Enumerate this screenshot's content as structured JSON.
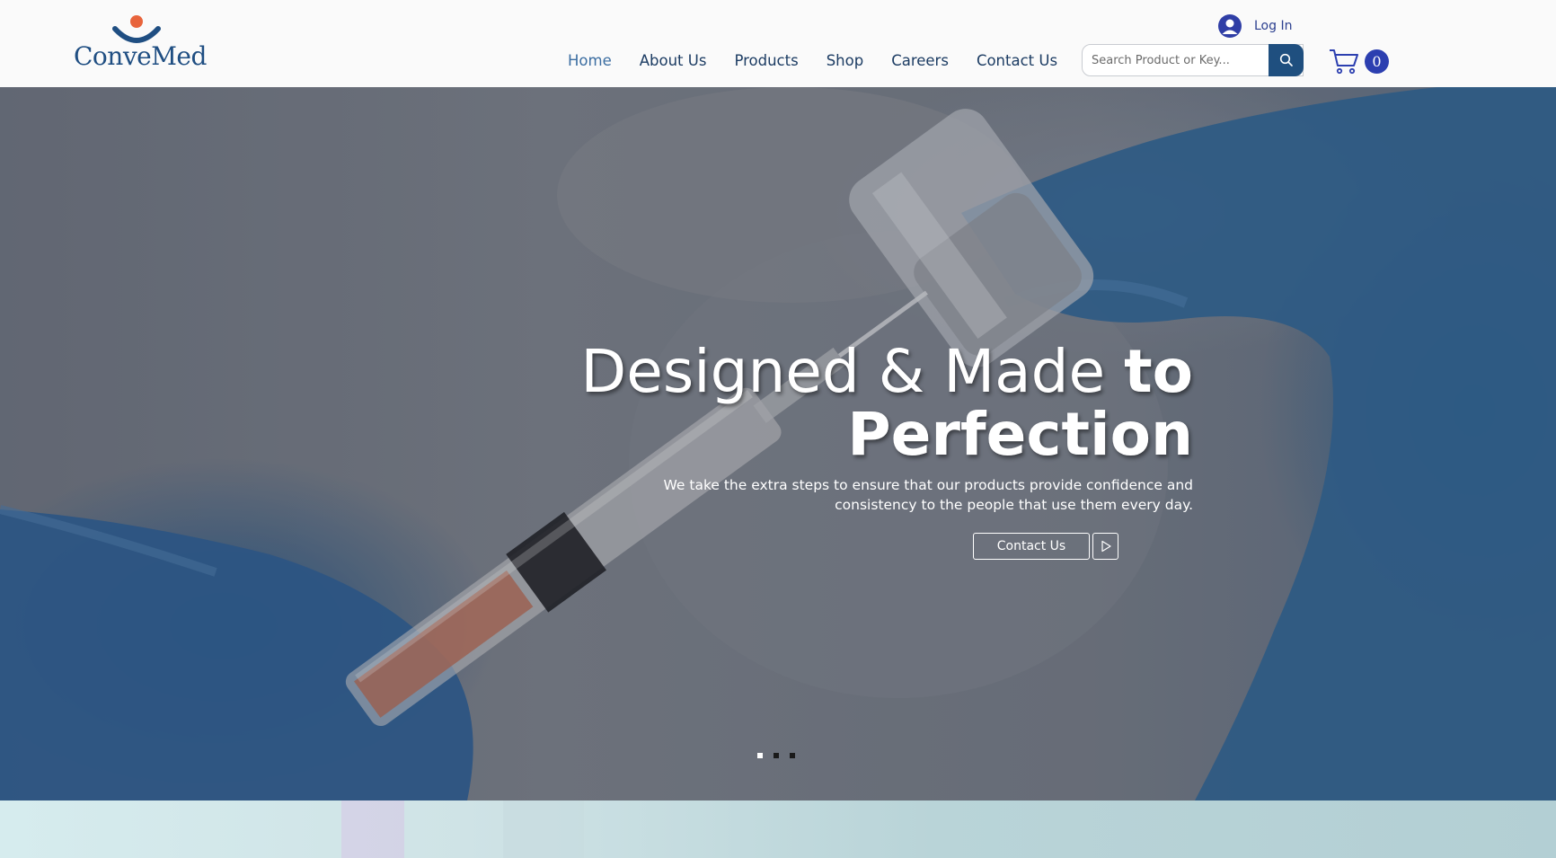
{
  "header": {
    "brand": "ConveMed",
    "nav": [
      {
        "label": "Home",
        "active": true
      },
      {
        "label": "About Us"
      },
      {
        "label": "Products"
      },
      {
        "label": "Shop"
      },
      {
        "label": "Careers"
      },
      {
        "label": "Contact Us"
      }
    ],
    "search": {
      "placeholder": "Search Product or Key..."
    },
    "login_label": "Log In",
    "cart_count": "0",
    "colors": {
      "brand": "#1f4e82",
      "accent_orange": "#e8643c",
      "button_blue": "#1f4f7f"
    }
  },
  "hero": {
    "title_light_1": "Designed & Made ",
    "title_bold_1": "to",
    "title_bold_2": "Perfection",
    "subtitle_line_1": "We take the extra steps to ensure that our products provide confidence and",
    "subtitle_line_2": "consistency to the people that use them every day.",
    "cta_label": "Contact Us",
    "slides": 3,
    "active_slide": 1
  }
}
